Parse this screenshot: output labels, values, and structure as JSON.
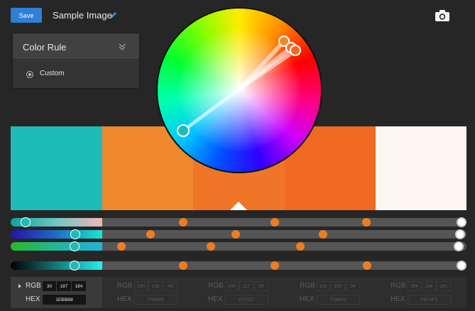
{
  "toolbar": {
    "save_label": "Save",
    "title": "Sample Image"
  },
  "color_rule": {
    "header": "Color Rule",
    "selected": "Custom"
  },
  "swatches": [
    "#1EBBB8",
    "#F0882E",
    "#F07527",
    "#F26922",
    "#FEF6F1"
  ],
  "selected_swatch_index": 2,
  "values": [
    {
      "rgb": [
        "30",
        "187",
        "184"
      ],
      "hex": "1EBBB8",
      "rgb_label": "RGB",
      "hex_label": "HEX",
      "active": true
    },
    {
      "rgb": [
        "240",
        "136",
        "46"
      ],
      "hex": "F0882E",
      "rgb_label": "RGB",
      "hex_label": "HEX",
      "active": false
    },
    {
      "rgb": [
        "240",
        "117",
        "39"
      ],
      "hex": "F07527",
      "rgb_label": "RGB",
      "hex_label": "HEX",
      "active": false
    },
    {
      "rgb": [
        "242",
        "105",
        "34"
      ],
      "hex": "F26922",
      "rgb_label": "RGB",
      "hex_label": "HEX",
      "active": false
    },
    {
      "rgb": [
        "254",
        "246",
        "241"
      ],
      "hex": "FEF6F1",
      "rgb_label": "RGB",
      "hex_label": "HEX",
      "active": false
    }
  ],
  "colors": {
    "accent": "#2F7FD6",
    "background": "#262626",
    "panel": "#3B3B3B"
  },
  "icons": {
    "edit": "pencil-icon",
    "capture": "camera-icon",
    "collapse": "double-chevron-icon"
  }
}
